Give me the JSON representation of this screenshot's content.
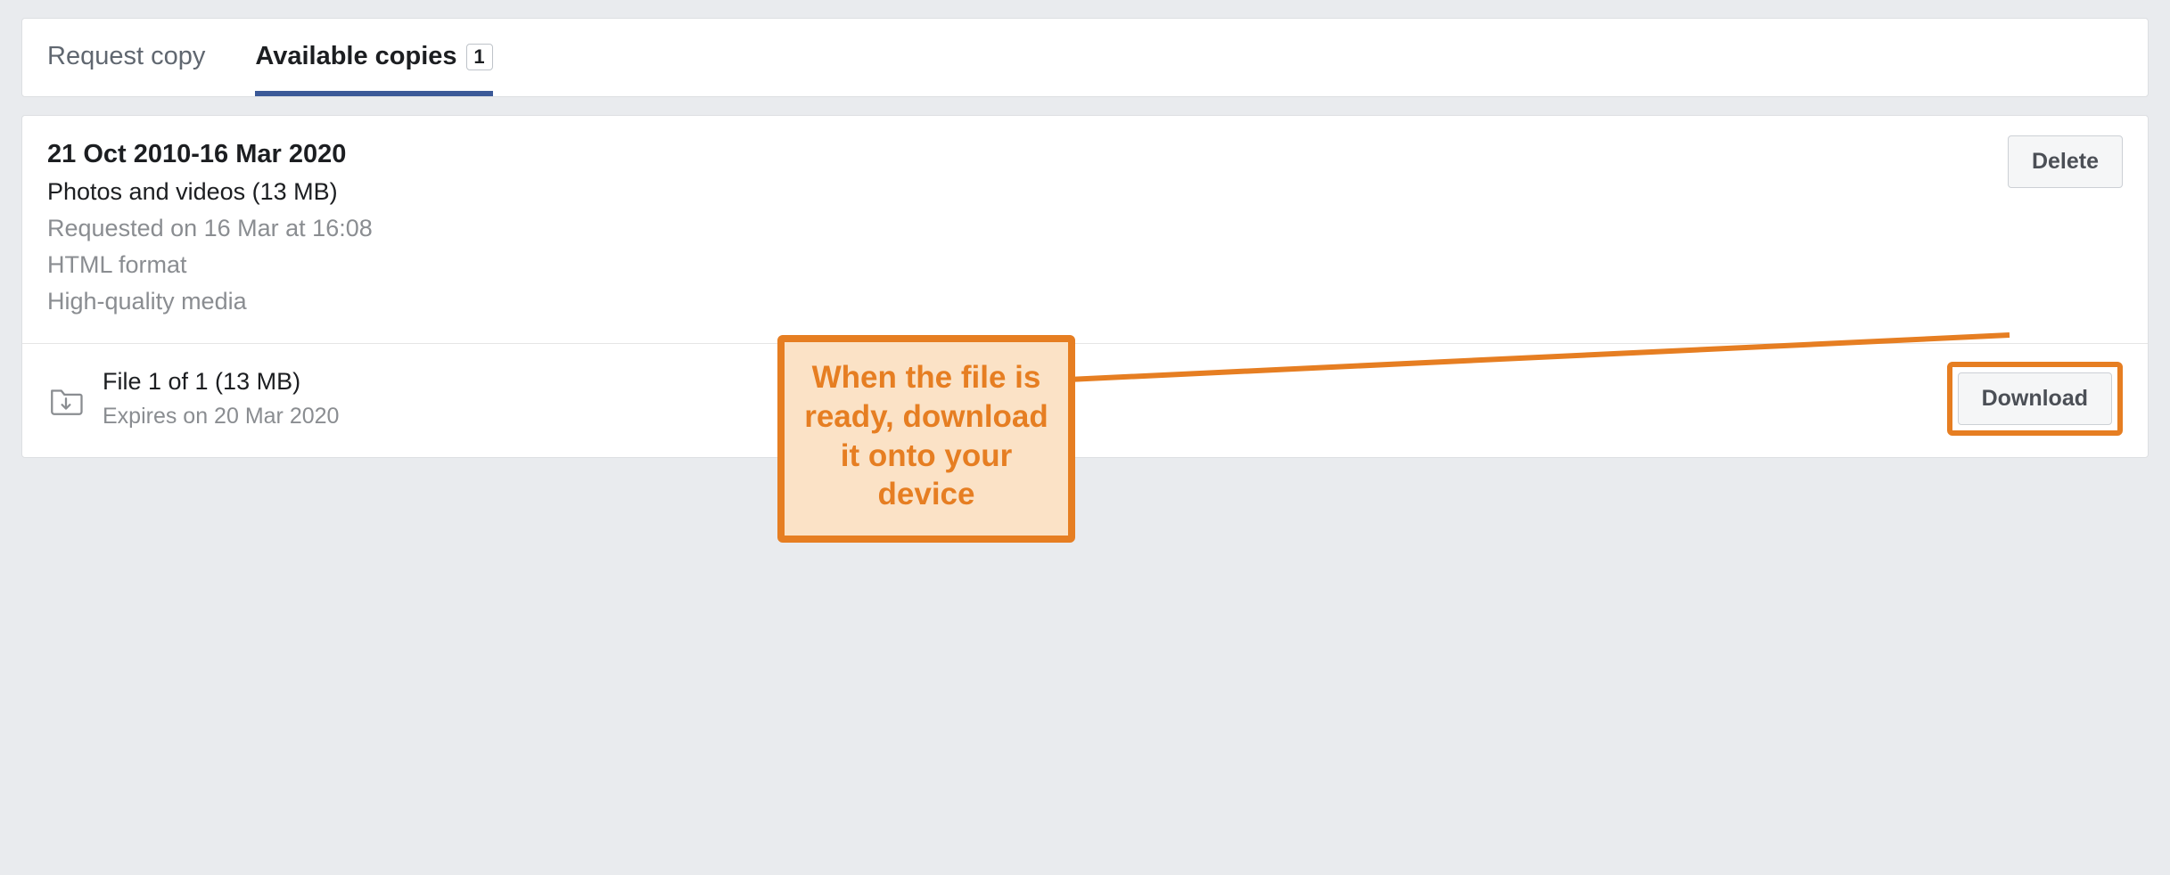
{
  "tabs": {
    "request_copy": "Request copy",
    "available_copies": "Available copies",
    "available_count": "1"
  },
  "copy": {
    "date_range": "21 Oct 2010-16 Mar 2020",
    "content": "Photos and videos (13 MB)",
    "requested": "Requested on 16 Mar at 16:08",
    "format": "HTML format",
    "quality": "High-quality media",
    "delete_label": "Delete"
  },
  "file": {
    "name": "File 1 of 1 (13 MB)",
    "expires": "Expires on 20 Mar 2020",
    "download_label": "Download"
  },
  "callout": {
    "text": "When the file is ready, download it onto your device"
  }
}
